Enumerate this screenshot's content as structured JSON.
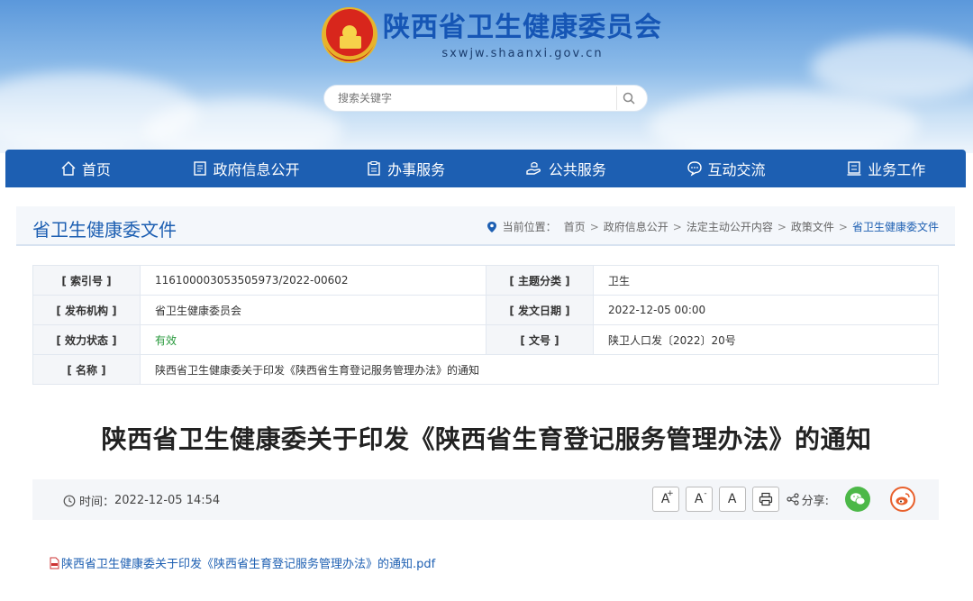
{
  "header": {
    "site_title": "陕西省卫生健康委员会",
    "site_domain": "sxwjw.shaanxi.gov.cn",
    "search_placeholder": "搜索关键字"
  },
  "nav": {
    "items": [
      {
        "label": "首页",
        "icon": "home-icon"
      },
      {
        "label": "政府信息公开",
        "icon": "document-list-icon"
      },
      {
        "label": "办事服务",
        "icon": "clipboard-icon"
      },
      {
        "label": "公共服务",
        "icon": "hand-service-icon"
      },
      {
        "label": "互动交流",
        "icon": "chat-icon"
      },
      {
        "label": "业务工作",
        "icon": "briefcase-icon"
      }
    ]
  },
  "section": {
    "title": "省卫生健康委文件",
    "breadcrumb_prefix": "当前位置：",
    "breadcrumb": [
      "首页",
      "政府信息公开",
      "法定主动公开内容",
      "政策文件",
      "省卫生健康委文件"
    ]
  },
  "meta": {
    "index_label": "[ 索引号 ]",
    "index_value": "116100003053505973/2022-00602",
    "topic_label": "[ 主题分类 ]",
    "topic_value": "卫生",
    "publisher_label": "[ 发布机构 ]",
    "publisher_value": "省卫生健康委员会",
    "date_label": "[ 发文日期 ]",
    "date_value": "2022-12-05 00:00",
    "status_label": "[ 效力状态 ]",
    "status_value": "有效",
    "docno_label": "[ 文号 ]",
    "docno_value": "陕卫人口发〔2022〕20号",
    "name_label": "[ 名称 ]",
    "name_value": "陕西省卫生健康委关于印发《陕西省生育登记服务管理办法》的通知"
  },
  "article": {
    "title": "陕西省卫生健康委关于印发《陕西省生育登记服务管理办法》的通知",
    "time_label": "时间：",
    "time_value": "2022-12-05 14:54",
    "font_large": "A",
    "font_large_sup": "+",
    "font_small": "A",
    "font_small_sup": "-",
    "font_default": "A",
    "share_label": "分享:",
    "attachment": "陕西省卫生健康委关于印发《陕西省生育登记服务管理办法》的通知.pdf"
  },
  "colors": {
    "nav_bg": "#1d5fb2",
    "accent": "#1d5fb2",
    "valid_green": "#2a9a3e"
  }
}
